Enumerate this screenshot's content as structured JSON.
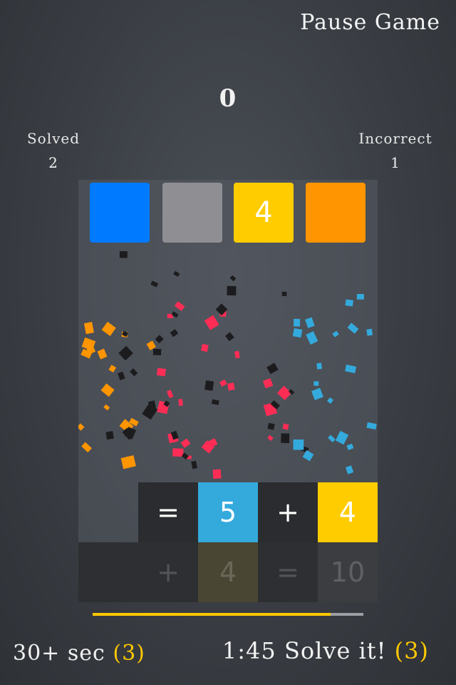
{
  "header": {
    "pause_label": "Pause Game",
    "score": "0"
  },
  "stats": {
    "solved_label": "Solved",
    "solved_value": "2",
    "incorrect_label": "Incorrect",
    "incorrect_value": "1"
  },
  "top_tiles": [
    {
      "color": "#007aff",
      "text": ""
    },
    {
      "color": "#8e8e93",
      "text": ""
    },
    {
      "color": "#ffcc00",
      "text": "4"
    },
    {
      "color": "#ff9500",
      "text": ""
    }
  ],
  "equation_row": [
    {
      "text": "=",
      "color": "#2b2c2f"
    },
    {
      "text": "5",
      "color": "#34aadc"
    },
    {
      "text": "+",
      "color": "#2b2c2f"
    },
    {
      "text": "4",
      "color": "#ffcc00"
    }
  ],
  "ghost_row": [
    {
      "text": "",
      "color": "#2e2f32"
    },
    {
      "text": "+",
      "color": "#2e2f32"
    },
    {
      "text": "4",
      "color": "#4a4634"
    },
    {
      "text": "=",
      "color": "#2e2f32"
    },
    {
      "text": "10",
      "color": "#3c3d40"
    }
  ],
  "progress": {
    "fraction": 0.88,
    "fill_color": "#ffc800"
  },
  "footer": {
    "bonus_label": "30+ sec",
    "bonus_count": "(3)",
    "timer": "1:45",
    "solve_label": "Solve it!",
    "solve_count": "(3)"
  },
  "colors": {
    "accent": "#ffc800",
    "confetti": [
      "#ff2d55",
      "#ff9500",
      "#34aadc",
      "#1c1c1e"
    ]
  }
}
